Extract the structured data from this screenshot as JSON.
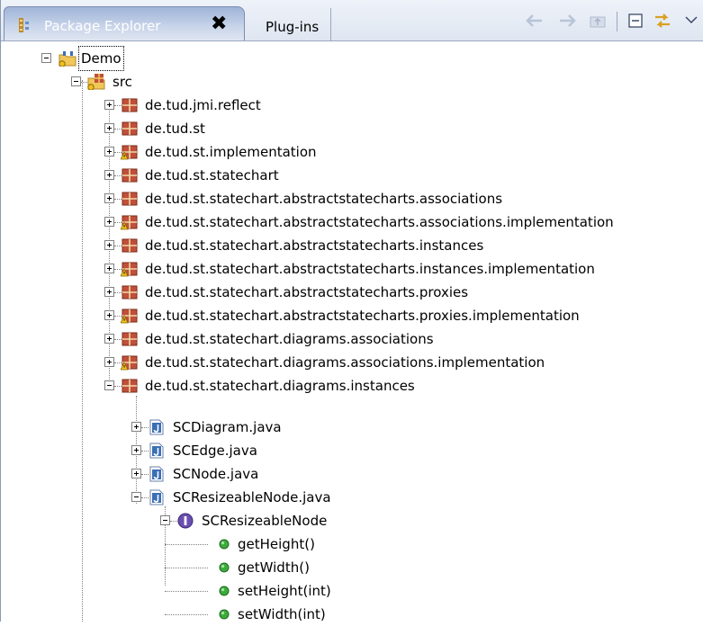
{
  "window": {
    "tabs": [
      {
        "label": "Package Explorer",
        "active": true,
        "close_glyph": "✖"
      },
      {
        "label": "Plug-ins",
        "active": false
      }
    ],
    "toolbar_icons": [
      "back-arrow-icon",
      "forward-arrow-icon",
      "up-folder-icon",
      "collapse-all-icon",
      "link-with-editor-icon",
      "view-menu-icon"
    ]
  },
  "tree": {
    "project": {
      "label": "Demo"
    },
    "source_folder": {
      "label": "src"
    },
    "packages": [
      {
        "label": "de.tud.jmi.reflect",
        "warning": false
      },
      {
        "label": "de.tud.st",
        "warning": false
      },
      {
        "label": "de.tud.st.implementation",
        "warning": true
      },
      {
        "label": "de.tud.st.statechart",
        "warning": false
      },
      {
        "label": "de.tud.st.statechart.abstractstatecharts.associations",
        "warning": false
      },
      {
        "label": "de.tud.st.statechart.abstractstatecharts.associations.implementation",
        "warning": true
      },
      {
        "label": "de.tud.st.statechart.abstractstatecharts.instances",
        "warning": false
      },
      {
        "label": "de.tud.st.statechart.abstractstatecharts.instances.implementation",
        "warning": true
      },
      {
        "label": "de.tud.st.statechart.abstractstatecharts.proxies",
        "warning": false
      },
      {
        "label": "de.tud.st.statechart.abstractstatecharts.proxies.implementation",
        "warning": true
      },
      {
        "label": "de.tud.st.statechart.diagrams.associations",
        "warning": false
      },
      {
        "label": "de.tud.st.statechart.diagrams.associations.implementation",
        "warning": true
      },
      {
        "label": "de.tud.st.statechart.diagrams.instances",
        "warning": false
      }
    ],
    "files": [
      {
        "label": "SCDiagram.java"
      },
      {
        "label": "SCEdge.java"
      },
      {
        "label": "SCNode.java"
      },
      {
        "label": "SCResizeableNode.java"
      }
    ],
    "interface": {
      "label": "SCResizeableNode"
    },
    "methods": [
      {
        "label": "getHeight()"
      },
      {
        "label": "getWidth()"
      },
      {
        "label": "setHeight(int)"
      },
      {
        "label": "setWidth(int)"
      }
    ]
  },
  "colors": {
    "package": "#c0503a",
    "package_dark": "#7a2b1a",
    "warning": "#f0c020",
    "java_file": "#3a6fb5",
    "interface": "#6a4fb0",
    "method": "#3caa3c",
    "tab_active": "#9fb4d8"
  }
}
